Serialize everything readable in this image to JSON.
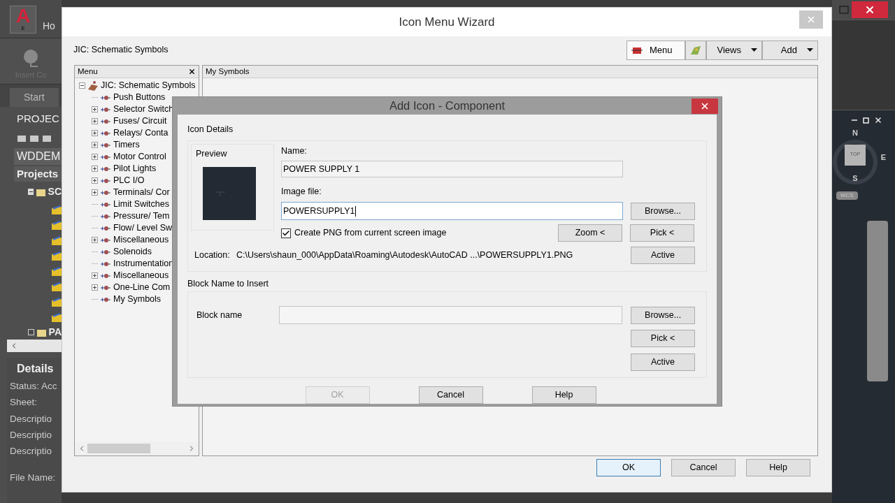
{
  "app": {
    "menu_letter": "A",
    "menu_sub": "E",
    "ribbon_tab": "Ho",
    "ribbon_tool": "Insert Co",
    "start_tab": "Start",
    "palette_title": "PROJEC",
    "project_name": "WDDEM",
    "projects_heading": "Projects",
    "folders": [
      {
        "label": "SC",
        "expanded": true
      },
      {
        "label": "PA",
        "expanded": false
      }
    ],
    "details_heading": "Details",
    "details": [
      "Status: Acc",
      "Sheet:",
      "Descriptio",
      "Descriptio",
      "Descriptio",
      "File Name:"
    ],
    "viewcube": {
      "north": "N",
      "east": "E",
      "south": "S",
      "face": "TOP",
      "ucs": "WCS"
    }
  },
  "wizard": {
    "title": "Icon Menu Wizard",
    "breadcrumb": "JIC: Schematic Symbols",
    "toolbar": [
      {
        "kind": "icon_label",
        "label": "Menu"
      },
      {
        "kind": "icon"
      },
      {
        "kind": "dropdown",
        "label": "Views"
      },
      {
        "kind": "dropdown",
        "label": "Add"
      }
    ],
    "menu_panel": {
      "title": "Menu",
      "root": {
        "label": "JIC: Schematic Symbols",
        "expanded": true,
        "children": [
          {
            "label": "Push Buttons",
            "expandable": false
          },
          {
            "label": "Selector Switch",
            "expandable": true
          },
          {
            "label": "Fuses/ Circuit",
            "expandable": true
          },
          {
            "label": "Relays/ Conta",
            "expandable": true
          },
          {
            "label": "Timers",
            "expandable": true
          },
          {
            "label": "Motor Control",
            "expandable": true
          },
          {
            "label": "Pilot Lights",
            "expandable": true
          },
          {
            "label": "PLC I/O",
            "expandable": true
          },
          {
            "label": "Terminals/ Cor",
            "expandable": true
          },
          {
            "label": "Limit Switches",
            "expandable": false
          },
          {
            "label": "Pressure/ Tem",
            "expandable": false
          },
          {
            "label": "Flow/ Level Sw",
            "expandable": false
          },
          {
            "label": "Miscellaneous",
            "expandable": true
          },
          {
            "label": "Solenoids",
            "expandable": false
          },
          {
            "label": "Instrumentation",
            "expandable": false
          },
          {
            "label": "Miscellaneous",
            "expandable": true
          },
          {
            "label": "One-Line Com",
            "expandable": true
          },
          {
            "label": "My Symbols",
            "expandable": false
          }
        ]
      }
    },
    "symbols_panel": {
      "title": "My Symbols"
    },
    "buttons": [
      {
        "label": "OK",
        "default": true
      },
      {
        "label": "Cancel",
        "default": false
      },
      {
        "label": "Help",
        "default": false
      }
    ]
  },
  "dialog": {
    "title": "Add Icon - Component",
    "icon_details": {
      "heading": "Icon Details",
      "preview_label": "Preview",
      "name_label": "Name:",
      "name_value": "POWER SUPPLY 1",
      "image_label": "Image file:",
      "image_value": "POWERSUPPLY1",
      "image_focused": true,
      "create_png": {
        "label": "Create PNG from current screen image",
        "checked": true
      },
      "location_label": "Location:",
      "location_value": "C:\\Users\\shaun_000\\AppData\\Roaming\\Autodesk\\AutoCAD ...\\POWERSUPPLY1.PNG",
      "browse": "Browse...",
      "zoom": "Zoom <",
      "pick": "Pick <",
      "active": "Active"
    },
    "block": {
      "heading": "Block Name to Insert",
      "label": "Block name",
      "browse": "Browse...",
      "pick": "Pick <",
      "active": "Active"
    },
    "buttons": [
      {
        "label": "OK",
        "disabled": true
      },
      {
        "label": "Cancel",
        "disabled": false
      },
      {
        "label": "Help",
        "disabled": false
      }
    ]
  }
}
